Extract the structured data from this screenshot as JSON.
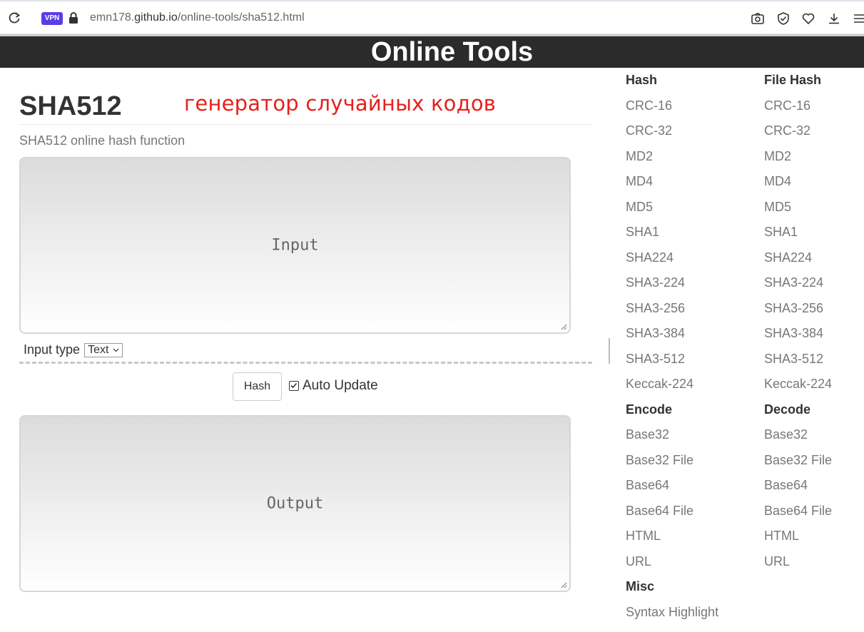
{
  "browser": {
    "vpn_label": "VPN",
    "url_prefix": "emn178.",
    "url_domain": "github.io",
    "url_path": "/online-tools/sha512.html"
  },
  "header": {
    "title": "Online Tools"
  },
  "main": {
    "title": "SHA512",
    "annotation": "генератор случайных кодов",
    "subtitle": "SHA512 online hash function",
    "input_placeholder": "Input",
    "input_type_label": "Input type",
    "input_type_value": "Text",
    "hash_button": "Hash",
    "auto_update_label": "Auto Update",
    "auto_update_checked": true,
    "output_placeholder": "Output"
  },
  "sidebar": {
    "col1": [
      {
        "type": "head",
        "label": "Hash"
      },
      {
        "type": "link",
        "label": "CRC-16"
      },
      {
        "type": "link",
        "label": "CRC-32"
      },
      {
        "type": "link",
        "label": "MD2"
      },
      {
        "type": "link",
        "label": "MD4"
      },
      {
        "type": "link",
        "label": "MD5"
      },
      {
        "type": "link",
        "label": "SHA1"
      },
      {
        "type": "link",
        "label": "SHA224"
      },
      {
        "type": "link",
        "label": "SHA3-224"
      },
      {
        "type": "link",
        "label": "SHA3-256"
      },
      {
        "type": "link",
        "label": "SHA3-384"
      },
      {
        "type": "link",
        "label": "SHA3-512"
      },
      {
        "type": "link",
        "label": "Keccak-224"
      },
      {
        "type": "head",
        "label": "Encode"
      },
      {
        "type": "link",
        "label": "Base32"
      },
      {
        "type": "link",
        "label": "Base32 File"
      },
      {
        "type": "link",
        "label": "Base64"
      },
      {
        "type": "link",
        "label": "Base64 File"
      },
      {
        "type": "link",
        "label": "HTML"
      },
      {
        "type": "link",
        "label": "URL"
      },
      {
        "type": "head",
        "label": "Misc"
      },
      {
        "type": "link",
        "label": "Syntax Highlight"
      }
    ],
    "col2": [
      {
        "type": "head",
        "label": "File Hash"
      },
      {
        "type": "link",
        "label": "CRC-16"
      },
      {
        "type": "link",
        "label": "CRC-32"
      },
      {
        "type": "link",
        "label": "MD2"
      },
      {
        "type": "link",
        "label": "MD4"
      },
      {
        "type": "link",
        "label": "MD5"
      },
      {
        "type": "link",
        "label": "SHA1"
      },
      {
        "type": "link",
        "label": "SHA224"
      },
      {
        "type": "link",
        "label": "SHA3-224"
      },
      {
        "type": "link",
        "label": "SHA3-256"
      },
      {
        "type": "link",
        "label": "SHA3-384"
      },
      {
        "type": "link",
        "label": "SHA3-512"
      },
      {
        "type": "link",
        "label": "Keccak-224"
      },
      {
        "type": "head",
        "label": "Decode"
      },
      {
        "type": "link",
        "label": "Base32"
      },
      {
        "type": "link",
        "label": "Base32 File"
      },
      {
        "type": "link",
        "label": "Base64"
      },
      {
        "type": "link",
        "label": "Base64 File"
      },
      {
        "type": "link",
        "label": "HTML"
      },
      {
        "type": "link",
        "label": "URL"
      }
    ]
  }
}
